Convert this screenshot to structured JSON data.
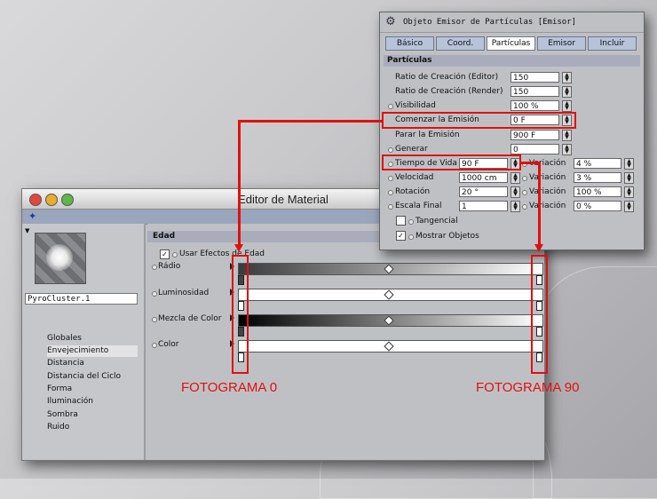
{
  "material_editor": {
    "title": "Editor de Material",
    "material_name": "PyroCluster.1",
    "nav": [
      {
        "label": "Globales",
        "selected": false
      },
      {
        "label": "Envejecimiento",
        "selected": true
      },
      {
        "label": "Distancia",
        "selected": false
      },
      {
        "label": "Distancia del Ciclo",
        "selected": false
      },
      {
        "label": "Forma",
        "selected": false
      },
      {
        "label": "Iluminación",
        "selected": false
      },
      {
        "label": "Sombra",
        "selected": false
      },
      {
        "label": "Ruido",
        "selected": false
      }
    ],
    "section_title": "Edad",
    "use_age_effects_label": "Usar Efectos de Edad",
    "use_age_effects_checked": true,
    "gradients": [
      {
        "label": "Rádio"
      },
      {
        "label": "Luminosidad"
      },
      {
        "label": "Mezcla de Color"
      },
      {
        "label": "Color"
      }
    ]
  },
  "emitter": {
    "title": "Objeto Emisor de Partículas  [Emisor]",
    "tabs": [
      "Básico",
      "Coord.",
      "Partículas",
      "Emisor",
      "Incluir"
    ],
    "active_tab": "Partículas",
    "section_title": "Partículas",
    "params": [
      {
        "label": "Ratio de Creación (Editor)",
        "value": "150"
      },
      {
        "label": "Ratio de Creación (Render)",
        "value": "150"
      },
      {
        "label": "Visibilidad",
        "value": "100 %"
      },
      {
        "label": "Comenzar la Emisión",
        "value": "0 F"
      },
      {
        "label": "Parar la Emisión",
        "value": "900 F"
      },
      {
        "label": "Generar",
        "value": "0"
      }
    ],
    "pair_params": [
      {
        "label": "Tiempo de Vida",
        "value": "90 F",
        "var_label": "Variación",
        "var_value": "4 %"
      },
      {
        "label": "Velocidad",
        "value": "1000 cm",
        "var_label": "Variación",
        "var_value": "3 %"
      },
      {
        "label": "Rotación",
        "value": "20 °",
        "var_label": "Variación",
        "var_value": "100 %"
      },
      {
        "label": "Escala Final",
        "value": "1",
        "var_label": "Variación",
        "var_value": "0 %"
      }
    ],
    "tangencial_label": "Tangencial",
    "tangencial_checked": false,
    "mostrar_label": "Mostrar Objetos",
    "mostrar_checked": true
  },
  "annotations": {
    "frame_start": "FOTOGRAMA 0",
    "frame_end": "FOTOGRAMA 90",
    "color": "#e01010"
  }
}
